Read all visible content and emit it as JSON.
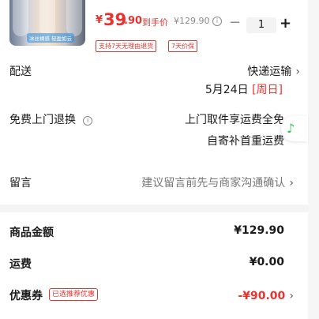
{
  "product": {
    "image_tags": [
      "冰丝裸感",
      "轻盈如云"
    ],
    "price_currency": "¥",
    "price_int": "39",
    "price_dec": ".90",
    "price_label": "到手价",
    "original_price": "¥129.90",
    "quantity": "1",
    "badges": [
      "支持7天无理由退货",
      "7天价保"
    ]
  },
  "shipping": {
    "label": "配送",
    "method": "快递运输",
    "date": "5月24日",
    "weekday": "[周日]"
  },
  "free_return": {
    "label": "免费上门退换",
    "line1": "上门取件享运费全免",
    "line2": "自寄补首重运费"
  },
  "message": {
    "label": "留言",
    "placeholder": "建议留言前先与商家沟通确认"
  },
  "summary": {
    "amount_label": "商品金额",
    "amount_value": "¥129.90",
    "freight_label": "运费",
    "freight_value": "¥0.00",
    "coupon_label": "优惠券",
    "coupon_tag": "已选推荐优惠",
    "coupon_value": "-¥90.00"
  },
  "colors": {
    "accent": "#e8332f",
    "float_icon": "#2fbf5f"
  }
}
